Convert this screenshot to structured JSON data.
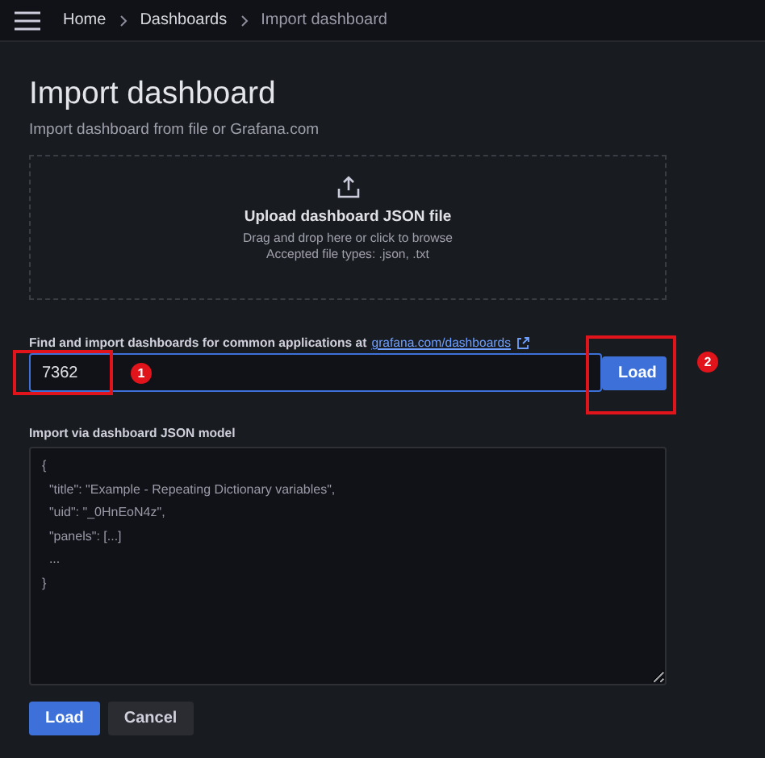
{
  "breadcrumbs": [
    {
      "label": "Home",
      "current": false
    },
    {
      "label": "Dashboards",
      "current": false
    },
    {
      "label": "Import dashboard",
      "current": true
    }
  ],
  "page": {
    "title": "Import dashboard",
    "subtitle": "Import dashboard from file or Grafana.com"
  },
  "upload": {
    "title": "Upload dashboard JSON file",
    "hint": "Drag and drop here or click to browse",
    "types": "Accepted file types: .json, .txt"
  },
  "grafana_import": {
    "label": "Find and import dashboards for common applications at",
    "link": "grafana.com/dashboards",
    "value": "7362",
    "button": "Load"
  },
  "json_import": {
    "label": "Import via dashboard JSON model",
    "placeholder_lines": [
      "{",
      "  \"title\": \"Example - Repeating Dictionary variables\",",
      "  \"uid\": \"_0HnEoN4z\",",
      "  \"panels\": [...]",
      "  ...",
      "}"
    ]
  },
  "buttons": [
    {
      "label": "Load",
      "kind": "primary"
    },
    {
      "label": "Cancel",
      "kind": "secondary"
    }
  ],
  "annotations": [
    {
      "number": "1"
    },
    {
      "number": "2"
    }
  ]
}
